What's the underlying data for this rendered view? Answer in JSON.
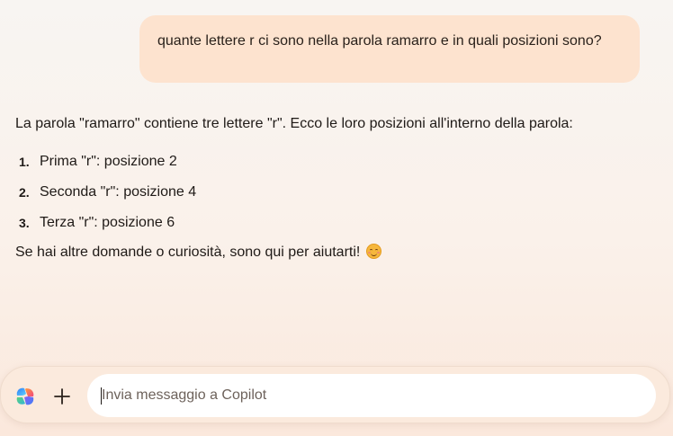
{
  "conversation": {
    "user_message": "quante lettere r ci sono nella parola ramarro e in quali posizioni sono?",
    "assistant": {
      "intro": "La parola \"ramarro\" contiene tre lettere \"r\". Ecco le loro posizioni all'interno della parola:",
      "items": [
        {
          "number": "1.",
          "text": "Prima \"r\": posizione 2"
        },
        {
          "number": "2.",
          "text": "Seconda \"r\": posizione 4"
        },
        {
          "number": "3.",
          "text": "Terza \"r\": posizione 6"
        }
      ],
      "outro": "Se hai altre domande o curiosità, sono qui per aiutarti!",
      "emoji": "smiling-face-emoji"
    }
  },
  "composer": {
    "placeholder": "Invia messaggio a Copilot",
    "value": "",
    "logo_icon": "copilot-logo-icon",
    "add_icon": "plus-icon"
  },
  "colors": {
    "user_bubble": "#fde3cf",
    "background_top": "#f8f5f2",
    "background_bottom": "#fbe8dc",
    "text": "#1f1a17"
  }
}
